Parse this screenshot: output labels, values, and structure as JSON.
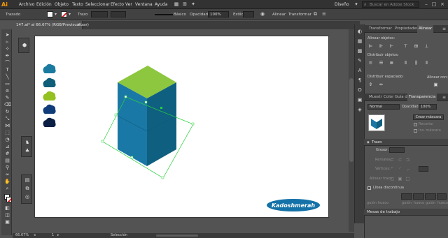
{
  "menubar": {
    "logo": "Ai",
    "items": [
      "Archivo",
      "Edición",
      "Objeto",
      "Texto",
      "Seleccionar",
      "Efecto",
      "Ver",
      "Ventana",
      "Ayuda"
    ],
    "workspace": "Diseño",
    "search_placeholder": "Buscar en Adobe Stock"
  },
  "controlbar": {
    "selection_label": "Trazado",
    "stroke_label": "Trazo",
    "brush_label": "Básico",
    "opacity_label": "Opacidad:",
    "opacity_value": "100%",
    "style_label": "Estilo:",
    "align_label": "Alinear",
    "transform_label": "Transformar"
  },
  "document": {
    "tab_title": "147.ai* al 66.67% (RGB/Previsualizar)",
    "close": "×"
  },
  "artwork": {
    "swatch_colors": [
      "#1b7aa0",
      "#0f5f7a",
      "#94c020",
      "#103c7a",
      "#0b1f44"
    ],
    "box_colors": {
      "top": "#8dc63f",
      "front": "#1a78a6",
      "side": "#0f5f80"
    },
    "logo_text": "Kadoshmerah",
    "logo_color": "#1472a8"
  },
  "statusbar": {
    "zoom": "66.67%",
    "artboard_num": "1",
    "tool_name": "Selección"
  },
  "panels": {
    "tabs_top": [
      "Transformar",
      "Propiedades",
      "Alinear"
    ],
    "align": {
      "align_objects": "Alinear objetos:",
      "distribute_objects": "Distribuir objetos:",
      "distribute_spacing": "Distribuir espaciado:",
      "align_to": "Alinear con:"
    },
    "tabs_mid": [
      "Muestr",
      "Color",
      "Guía d",
      "Transparencia"
    ],
    "transparency": {
      "blend_mode": "Normal",
      "opacity_label": "Opacidad:",
      "opacity_value": "100%",
      "make_mask": "Crear máscara",
      "clip": "Recortar",
      "invert_mask": "Inv. máscara"
    },
    "stroke": {
      "title": "Trazo",
      "weight_label": "Grosor:",
      "cap_label": "Remates:",
      "corner_label": "Vértices:",
      "align_label": "Alinear trazo:",
      "dashed_label": "Línea discontinua",
      "dash_labels": [
        "guión",
        "hueco",
        "guión",
        "hueco",
        "guión",
        "hueco"
      ]
    },
    "artboards": "Mesas de trabajo"
  }
}
